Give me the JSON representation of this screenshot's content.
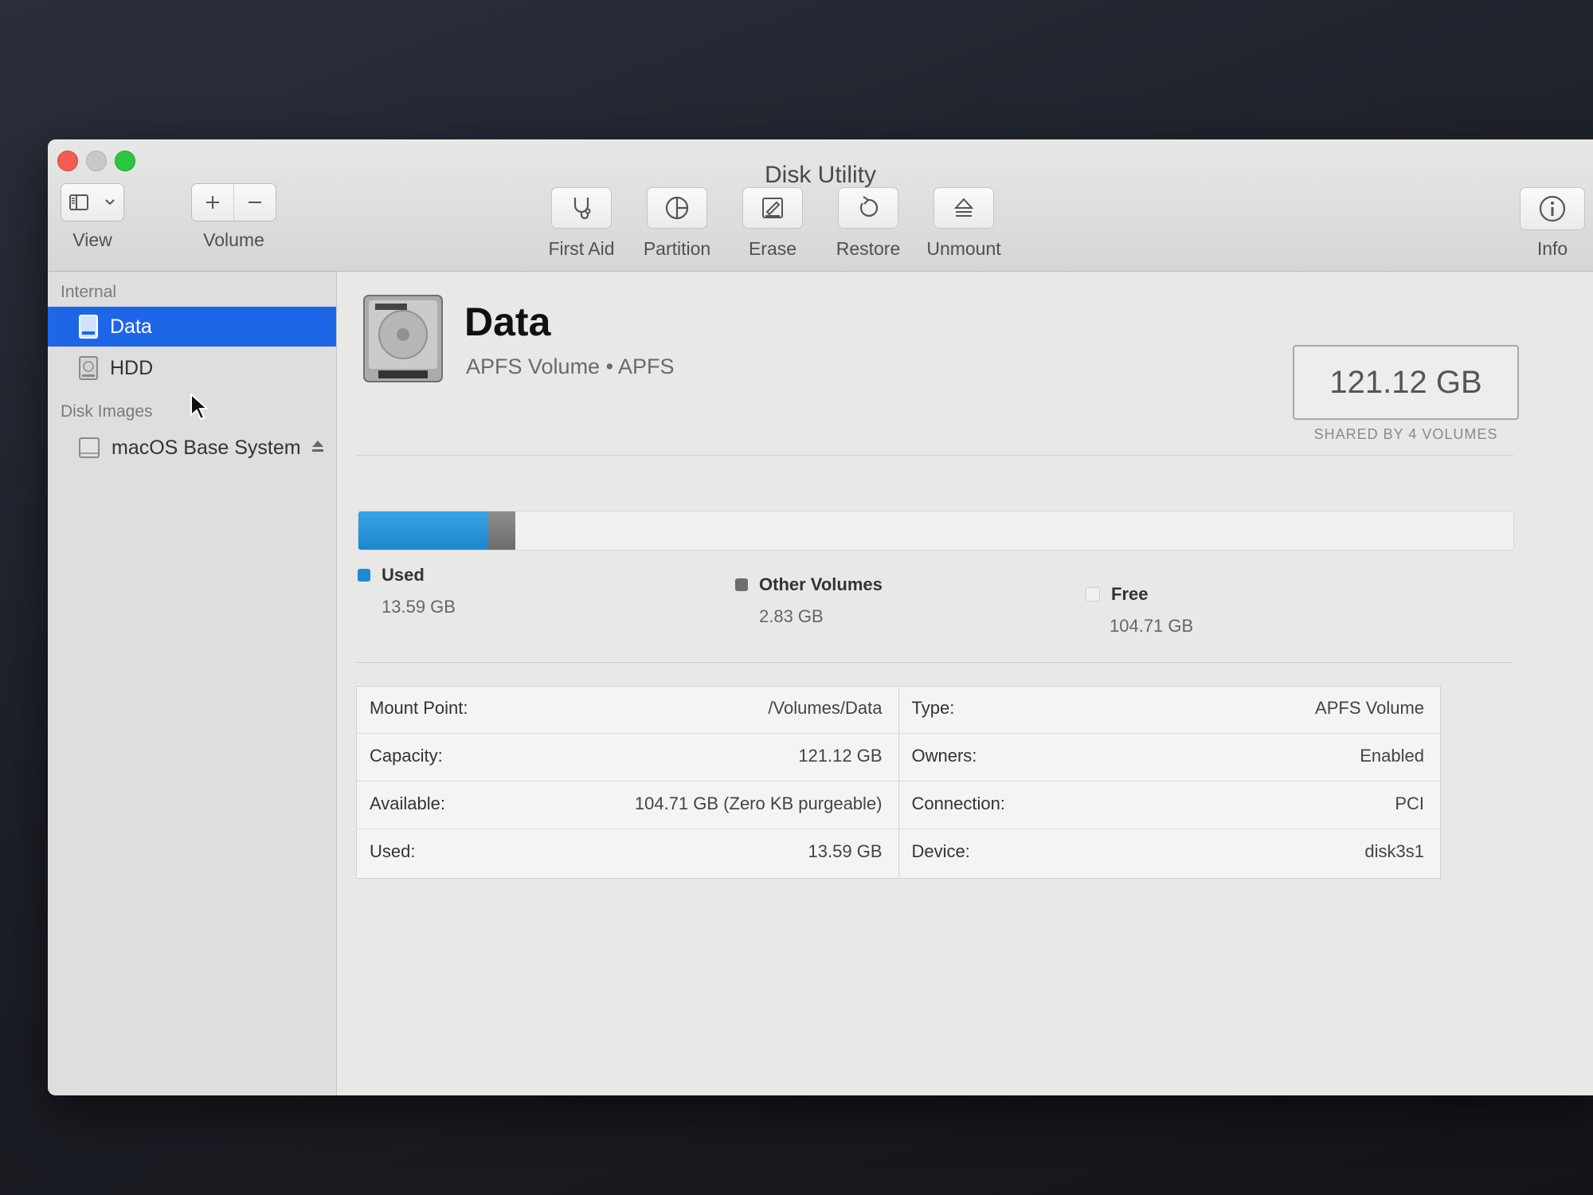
{
  "window": {
    "title": "Disk Utility"
  },
  "toolbar": {
    "view_label": "View",
    "volume_label": "Volume",
    "first_aid": "First Aid",
    "partition": "Partition",
    "erase": "Erase",
    "restore": "Restore",
    "unmount": "Unmount",
    "info": "Info"
  },
  "sidebar": {
    "internal_header": "Internal",
    "items": [
      {
        "label": "Data",
        "icon": "internal-drive-icon",
        "selected": true
      },
      {
        "label": "HDD",
        "icon": "internal-drive-icon",
        "selected": false
      }
    ],
    "disk_images_header": "Disk Images",
    "disk_images": [
      {
        "label": "macOS Base System",
        "icon": "external-disk-icon"
      }
    ]
  },
  "volume": {
    "name": "Data",
    "subtitle": "APFS Volume • APFS",
    "capacity": "121.12 GB",
    "capacity_caption": "SHARED BY 4 VOLUMES"
  },
  "usage": {
    "used": {
      "label": "Used",
      "value": "13.59 GB",
      "fraction": 0.1122,
      "color": "#1f8ad3"
    },
    "other": {
      "label": "Other Volumes",
      "value": "2.83 GB",
      "fraction": 0.0234,
      "color": "#7a7a78"
    },
    "free": {
      "label": "Free",
      "value": "104.71 GB",
      "fraction": 0.8645,
      "color": "#f1f1ef"
    }
  },
  "details": {
    "left": [
      {
        "label": "Mount Point:",
        "value": "/Volumes/Data"
      },
      {
        "label": "Capacity:",
        "value": "121.12 GB"
      },
      {
        "label": "Available:",
        "value": "104.71 GB (Zero KB purgeable)"
      },
      {
        "label": "Used:",
        "value": "13.59 GB"
      }
    ],
    "right": [
      {
        "label": "Type:",
        "value": "APFS Volume"
      },
      {
        "label": "Owners:",
        "value": "Enabled"
      },
      {
        "label": "Connection:",
        "value": "PCI"
      },
      {
        "label": "Device:",
        "value": "disk3s1"
      }
    ]
  }
}
